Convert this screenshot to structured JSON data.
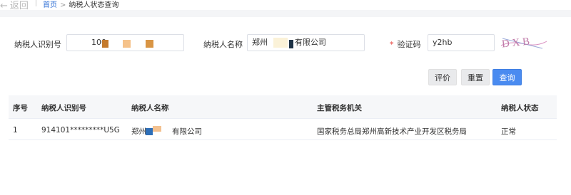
{
  "nav": {
    "back_label": "返回",
    "breadcrumb_home": "首页",
    "breadcrumb_sep": ">",
    "breadcrumb_current": "纳税人状态查询"
  },
  "form": {
    "taxpayer_id_label": "纳税人识别号",
    "taxpayer_id_value": "100",
    "taxpayer_name_label": "纳税人名称",
    "taxpayer_name_prefix": "郑州",
    "taxpayer_name_suffix": "有限公司",
    "captcha_required_mark": "*",
    "captcha_label": "验证码",
    "captcha_value": "y2hb",
    "captcha_image_text": "D X B"
  },
  "buttons": {
    "evaluate": "评价",
    "reset": "重置",
    "query": "查询"
  },
  "table": {
    "headers": [
      "序号",
      "纳税人识别号",
      "纳税人名称",
      "主管税务机关",
      "纳税人状态"
    ],
    "rows": [
      {
        "index": "1",
        "taxpayer_id": "914101*********U5G",
        "name_prefix": "郑州",
        "name_suffix": "有限公司",
        "tax_authority": "国家税务总局郑州高新技术产业开发区税务局",
        "status": "正常"
      }
    ]
  },
  "colors": {
    "accent": "#4a8bf0",
    "link": "#2f6fd6",
    "required": "#e8403a",
    "mask_orange": "#f0a24a",
    "mask_brown": "#c47a2c",
    "mask_blue": "#2e6fb8",
    "mask_dark": "#1f3346"
  }
}
